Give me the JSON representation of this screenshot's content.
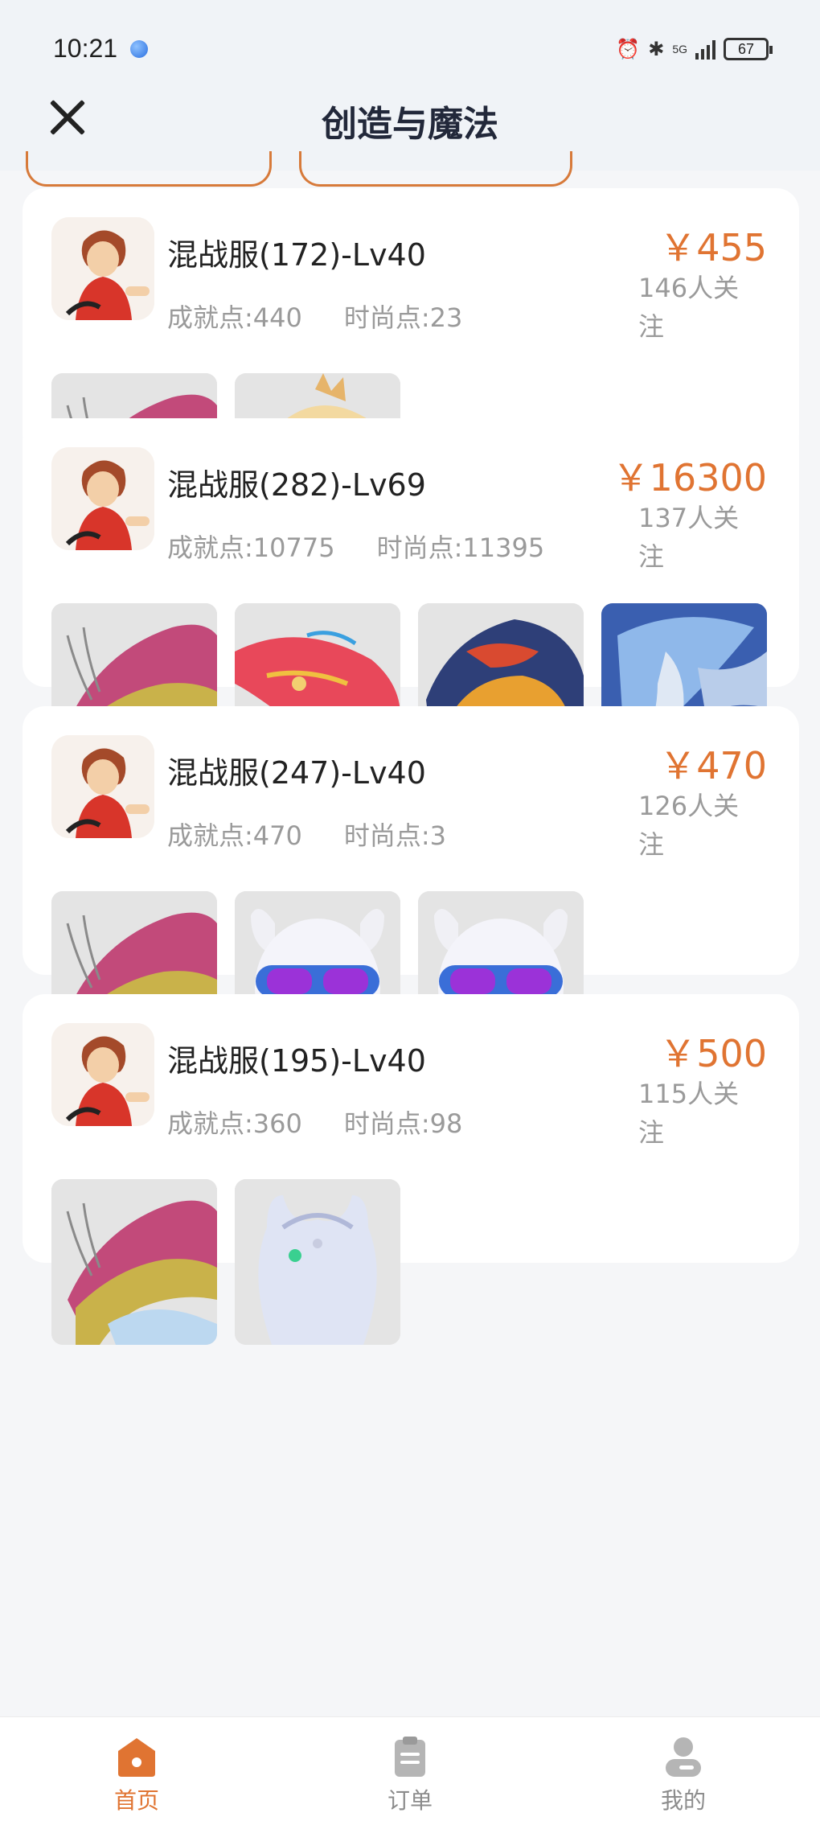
{
  "status": {
    "time": "10:21",
    "battery": "67",
    "network": "5G"
  },
  "nav": {
    "title": "创造与魔法",
    "close_icon": "close-icon"
  },
  "listings": [
    {
      "title": "混战服(172)-Lv40",
      "achievement": "成就点:440",
      "fashion": "时尚点:23",
      "price": "￥455",
      "followers": "146人关注",
      "thumbs": [
        "dragon",
        "parrot"
      ]
    },
    {
      "title": "混战服(282)-Lv69",
      "achievement": "成就点:10775",
      "fashion": "时尚点:11395",
      "price": "￥16300",
      "followers": "137人关注",
      "thumbs": [
        "dragon",
        "fish",
        "lion",
        "bluebird"
      ]
    },
    {
      "title": "混战服(247)-Lv40",
      "achievement": "成就点:470",
      "fashion": "时尚点:3",
      "price": "￥470",
      "followers": "126人关注",
      "thumbs": [
        "dragon",
        "dog",
        "dog"
      ]
    },
    {
      "title": "混战服(195)-Lv40",
      "achievement": "成就点:360",
      "fashion": "时尚点:98",
      "price": "￥500",
      "followers": "115人关注",
      "thumbs": [
        "dragon",
        "helmet"
      ]
    }
  ],
  "tabs": [
    {
      "label": "首页",
      "icon": "home-icon",
      "active": true
    },
    {
      "label": "订单",
      "icon": "order-icon",
      "active": false
    },
    {
      "label": "我的",
      "icon": "profile-icon",
      "active": false
    }
  ],
  "colors": {
    "accent": "#e07432",
    "background": "#f5f6f8",
    "card": "#ffffff",
    "muted_text": "#9a9a9a"
  }
}
